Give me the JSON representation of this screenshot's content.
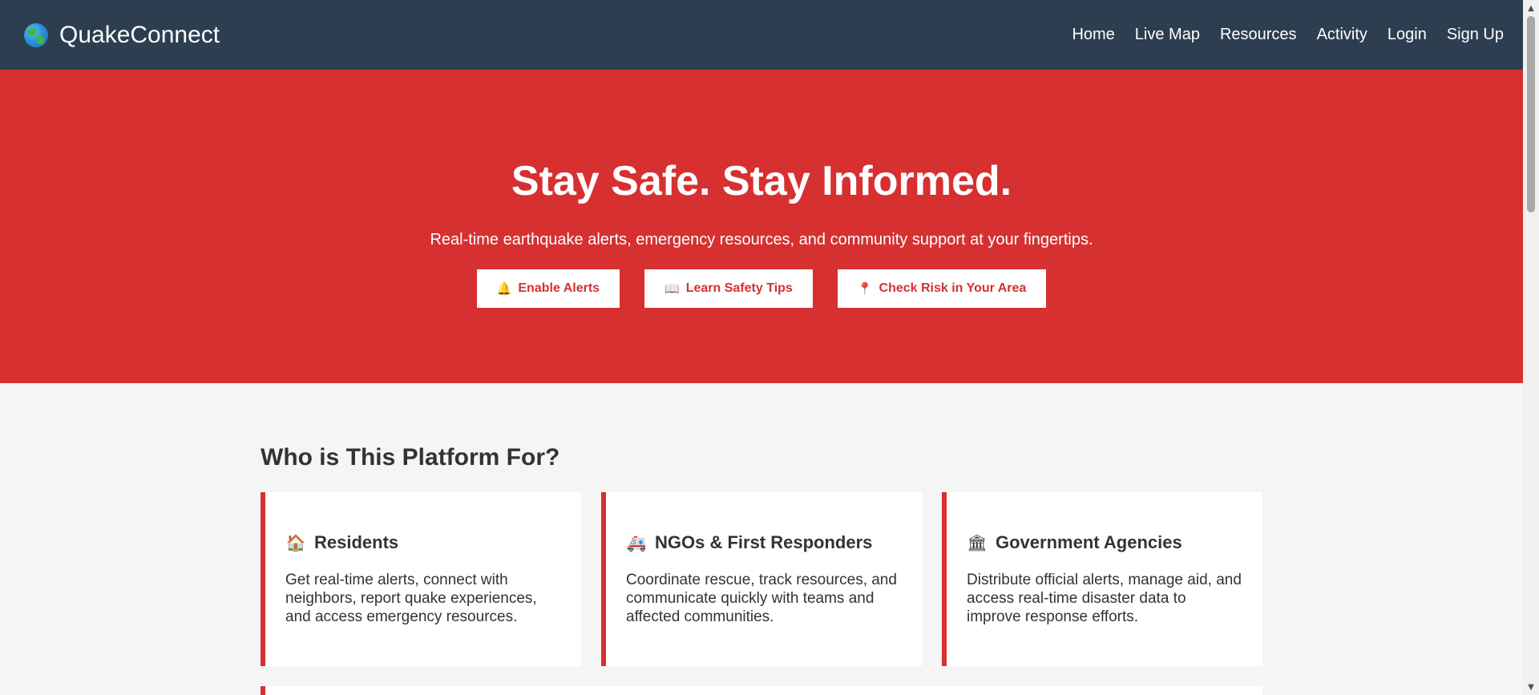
{
  "navbar": {
    "brand": "QuakeConnect",
    "brand_icon": "globe-icon",
    "links": [
      "Home",
      "Live Map",
      "Resources",
      "Activity",
      "Login",
      "Sign Up"
    ]
  },
  "hero": {
    "title": "Stay Safe. Stay Informed.",
    "subtitle": "Real-time earthquake alerts, emergency resources, and community support at your fingertips.",
    "buttons": [
      {
        "icon": "🔔",
        "icon_name": "bell-icon",
        "label": "Enable Alerts"
      },
      {
        "icon": "📖",
        "icon_name": "book-icon",
        "label": "Learn Safety Tips"
      },
      {
        "icon": "📍",
        "icon_name": "pin-icon",
        "label": "Check Risk in Your Area"
      }
    ]
  },
  "audience": {
    "title": "Who is This Platform For?",
    "cards": [
      {
        "icon": "🏠",
        "icon_name": "house-icon",
        "title": "Residents",
        "text": "Get real-time alerts, connect with neighbors, report quake experiences, and access emergency resources."
      },
      {
        "icon": "🚑",
        "icon_name": "ambulance-icon",
        "title": "NGOs & First Responders",
        "text": "Coordinate rescue, track resources, and communicate quickly with teams and affected communities."
      },
      {
        "icon": "🏛",
        "icon_name": "government-building-icon",
        "title": "Government Agencies",
        "text": "Distribute official alerts, manage aid, and access real-time disaster data to improve response efforts."
      }
    ]
  },
  "colors": {
    "navbar": "#2c3e50",
    "accent": "#d63031",
    "page_background": "#f5f5f5"
  }
}
